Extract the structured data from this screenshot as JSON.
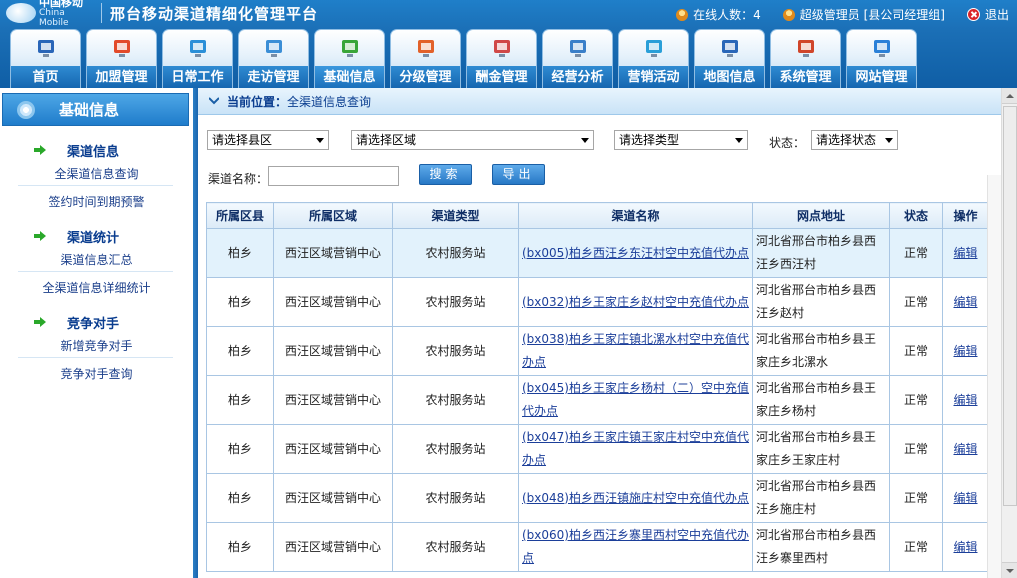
{
  "header": {
    "logo_cn": "中国移动",
    "logo_en": "China Mobile",
    "title": "邢台移动渠道精细化管理平台",
    "online_text": "在线人数：4",
    "user_text": "超级管理员 [县公司经理组]",
    "logout_label": "退出"
  },
  "nav": {
    "tabs": [
      {
        "label": "首页",
        "icon": "monitor-icon"
      },
      {
        "label": "加盟管理",
        "icon": "join-icon"
      },
      {
        "label": "日常工作",
        "icon": "daily-work-icon"
      },
      {
        "label": "走访管理",
        "icon": "visit-icon"
      },
      {
        "label": "基础信息",
        "icon": "basic-info-icon"
      },
      {
        "label": "分级管理",
        "icon": "grading-icon"
      },
      {
        "label": "酬金管理",
        "icon": "reward-icon"
      },
      {
        "label": "经营分析",
        "icon": "analysis-icon"
      },
      {
        "label": "营销活动",
        "icon": "marketing-icon"
      },
      {
        "label": "地图信息",
        "icon": "map-icon"
      },
      {
        "label": "系统管理",
        "icon": "settings-icon"
      },
      {
        "label": "网站管理",
        "icon": "globe-icon"
      }
    ]
  },
  "sidebar": {
    "title": "基础信息",
    "groups": [
      {
        "title": "渠道信息",
        "links": [
          "全渠道信息查询",
          "签约时间到期预警"
        ]
      },
      {
        "title": "渠道统计",
        "links": [
          "渠道信息汇总",
          "全渠道信息详细统计"
        ]
      },
      {
        "title": "竞争对手",
        "links": [
          "新增竞争对手",
          "竞争对手查询"
        ]
      }
    ]
  },
  "breadcrumb": {
    "label": "当前位置：",
    "value": "全渠道信息查询"
  },
  "filters": {
    "county": "请选择县区",
    "area": "请选择区域",
    "type": "请选择类型",
    "status_label": "状态：",
    "status": "请选择状态",
    "name_label": "渠道名称：",
    "name_value": "",
    "search_label": "搜索",
    "export_label": "导出"
  },
  "table": {
    "headers": [
      "所属区县",
      "所属区域",
      "渠道类型",
      "渠道名称",
      "网点地址",
      "状态",
      "操作"
    ],
    "rows": [
      {
        "county": "柏乡",
        "area": "西汪区域营销中心",
        "type": "农村服务站",
        "name": "(bx005)柏乡西汪乡东汪村空中充值代办点",
        "addr": "河北省邢台市柏乡县西汪乡西汪村",
        "status": "正常",
        "op": "编辑"
      },
      {
        "county": "柏乡",
        "area": "西汪区域营销中心",
        "type": "农村服务站",
        "name": "(bx032)柏乡王家庄乡赵村空中充值代办点",
        "addr": "河北省邢台市柏乡县西汪乡赵村",
        "status": "正常",
        "op": "编辑"
      },
      {
        "county": "柏乡",
        "area": "西汪区域营销中心",
        "type": "农村服务站",
        "name": "(bx038)柏乡王家庄镇北漯水村空中充值代办点",
        "addr": "河北省邢台市柏乡县王家庄乡北漯水",
        "status": "正常",
        "op": "编辑"
      },
      {
        "county": "柏乡",
        "area": "西汪区域营销中心",
        "type": "农村服务站",
        "name": "(bx045)柏乡王家庄乡杨村（二）空中充值代办点",
        "addr": "河北省邢台市柏乡县王家庄乡杨村",
        "status": "正常",
        "op": "编辑"
      },
      {
        "county": "柏乡",
        "area": "西汪区域营销中心",
        "type": "农村服务站",
        "name": "(bx047)柏乡王家庄镇王家庄村空中充值代办点",
        "addr": "河北省邢台市柏乡县王家庄乡王家庄村",
        "status": "正常",
        "op": "编辑"
      },
      {
        "county": "柏乡",
        "area": "西汪区域营销中心",
        "type": "农村服务站",
        "name": "(bx048)柏乡西汪镇施庄村空中充值代办点",
        "addr": "河北省邢台市柏乡县西汪乡施庄村",
        "status": "正常",
        "op": "编辑"
      },
      {
        "county": "柏乡",
        "area": "西汪区域营销中心",
        "type": "农村服务站",
        "name": "(bx060)柏乡西汪乡寨里西村空中充值代办点",
        "addr": "河北省邢台市柏乡县西汪乡寨里西村",
        "status": "正常",
        "op": "编辑"
      }
    ]
  }
}
